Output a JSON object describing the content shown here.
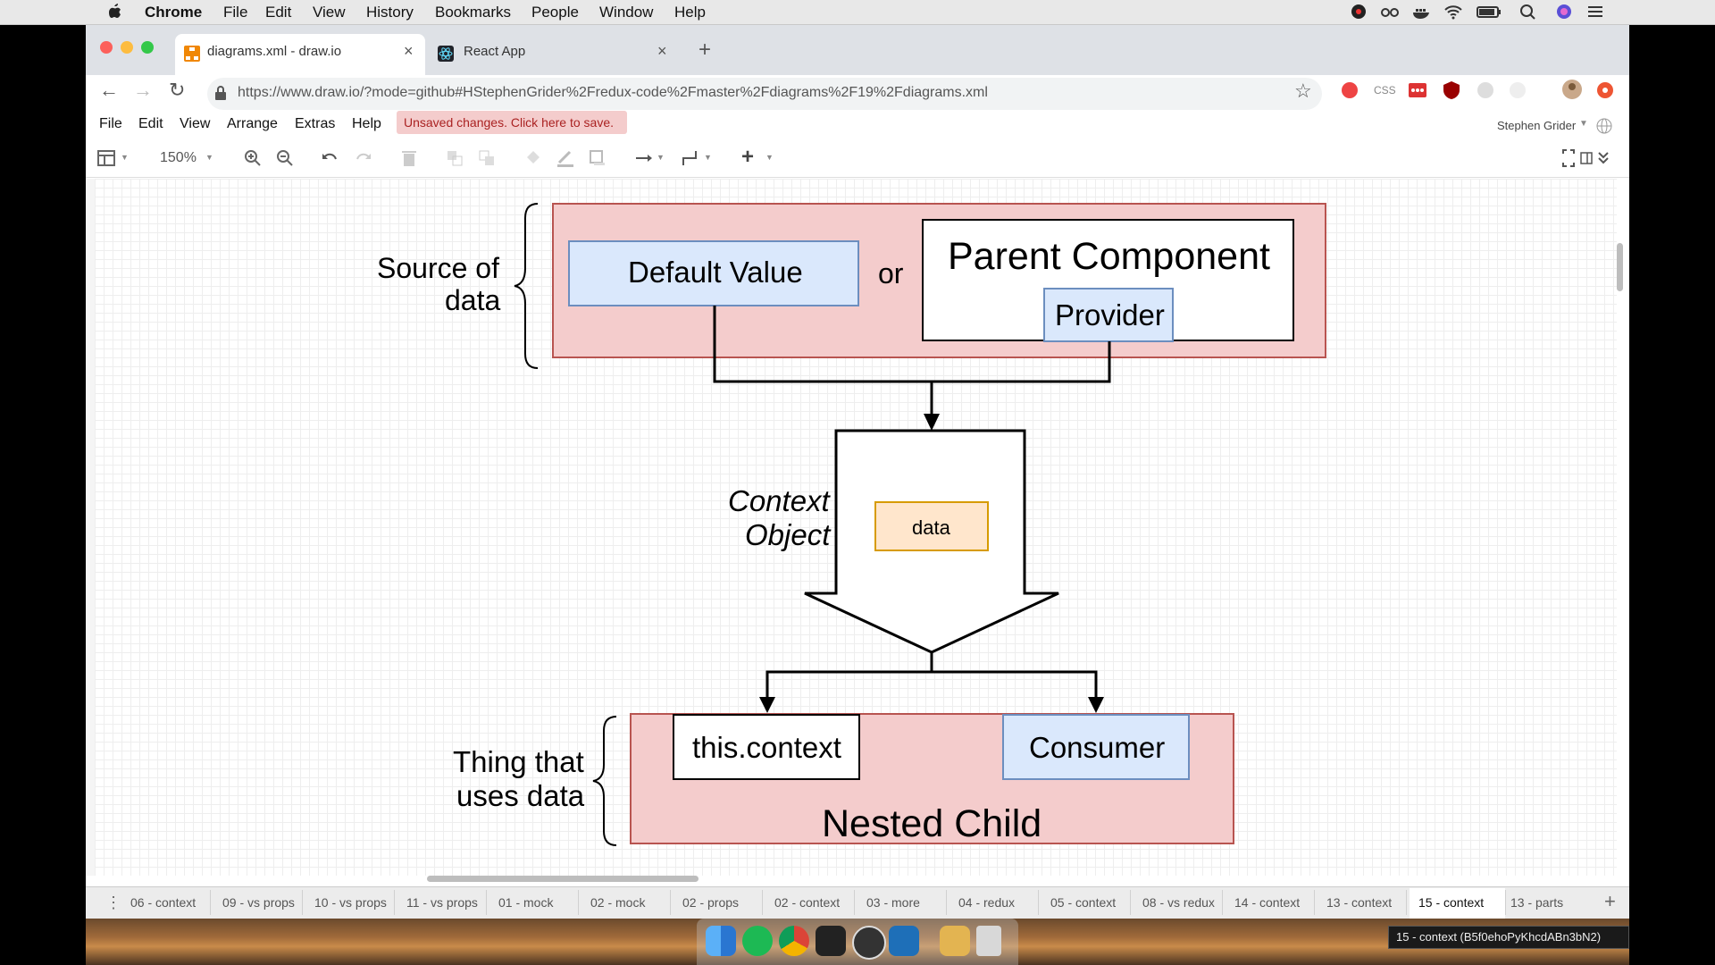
{
  "menubar": {
    "app": "Chrome",
    "items": [
      "File",
      "Edit",
      "View",
      "History",
      "Bookmarks",
      "People",
      "Window",
      "Help"
    ]
  },
  "browser": {
    "tabs": [
      {
        "title": "diagrams.xml - draw.io",
        "icon": "drawio-icon",
        "active": true
      },
      {
        "title": "React App",
        "icon": "react-icon",
        "active": false
      }
    ],
    "url": "https://www.draw.io/?mode=github#HStephenGrider%2Fredux-code%2Fmaster%2Fdiagrams%2F19%2Fdiagrams.xml"
  },
  "app_menu": {
    "items": [
      "File",
      "Edit",
      "View",
      "Arrange",
      "Extras",
      "Help"
    ],
    "unsaved": "Unsaved changes. Click here to save.",
    "user": "Stephen Grider"
  },
  "toolbar": {
    "zoom": "150%"
  },
  "diagram": {
    "source_label_1": "Source of",
    "source_label_2": "data",
    "default_value": "Default Value",
    "or_1": "or",
    "parent_component": "Parent Component",
    "provider": "Provider",
    "context_label_1": "Context",
    "context_label_2": "Object",
    "data": "data",
    "thing_label_1": "Thing that",
    "thing_label_2": "uses data",
    "this_context": "this.context",
    "consumer": "Consumer",
    "nested_child": "Nested Child"
  },
  "page_tabs": [
    "06 - context",
    "09 - vs props",
    "10 - vs props",
    "11 - vs props",
    "01 - mock",
    "02 - mock",
    "02 - props",
    "02 - context",
    "03 - more",
    "04 - redux",
    "05 - context",
    "08 - vs redux",
    "14 - context",
    "13 - context",
    "15 - context",
    "13 - parts"
  ],
  "selected_page": "15 - context",
  "tooltip": "15 - context (B5f0ehoPyKhcdABn3bN2)",
  "colors": {
    "pink_fill": "#f4cccc",
    "pink_stroke": "#b85450",
    "blue_fill": "#dae8fc",
    "blue_stroke": "#6c8ebf",
    "orange_fill": "#ffe6cc",
    "orange_stroke": "#d79b00"
  }
}
